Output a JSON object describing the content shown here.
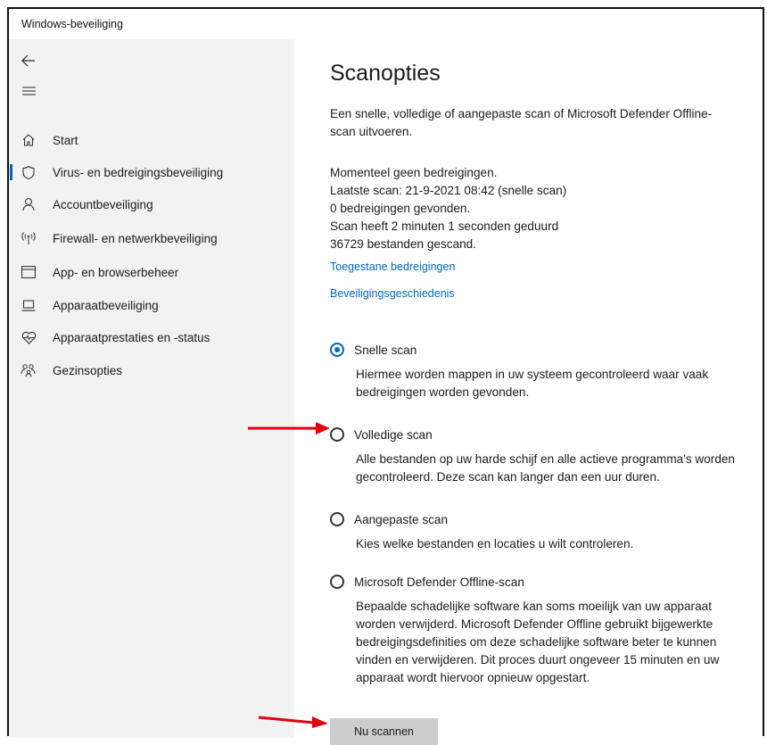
{
  "window": {
    "title": "Windows-beveiliging"
  },
  "sidebar": {
    "items": [
      {
        "label": "Start",
        "icon": "home-icon"
      },
      {
        "label": "Virus- en bedreigingsbeveiliging",
        "icon": "shield-icon",
        "active": true
      },
      {
        "label": "Accountbeveiliging",
        "icon": "person-icon"
      },
      {
        "label": "Firewall- en netwerkbeveiliging",
        "icon": "antenna-icon"
      },
      {
        "label": "App- en browserbeheer",
        "icon": "browser-window-icon"
      },
      {
        "label": "Apparaatbeveiliging",
        "icon": "laptop-icon"
      },
      {
        "label": "Apparaatprestaties en -status",
        "icon": "heart-pulse-icon"
      },
      {
        "label": "Gezinsopties",
        "icon": "family-icon"
      }
    ]
  },
  "main": {
    "title": "Scanopties",
    "description": "Een snelle, volledige of aangepaste scan of Microsoft Defender Offline-scan uitvoeren.",
    "status": {
      "line1": "Momenteel geen bedreigingen.",
      "line2": "Laatste scan: 21-9-2021 08:42 (snelle scan)",
      "line3": "0 bedreigingen gevonden.",
      "line4": "Scan heeft 2 minuten 1 seconden geduurd",
      "line5": "36729 bestanden gescand."
    },
    "links": {
      "allowed": "Toegestane bedreigingen",
      "history": "Beveiligingsgeschiedenis"
    },
    "options": [
      {
        "label": "Snelle scan",
        "description": "Hiermee worden mappen in uw systeem gecontroleerd waar vaak bedreigingen worden gevonden.",
        "selected": true
      },
      {
        "label": "Volledige scan",
        "description": "Alle bestanden op uw harde schijf en alle actieve programma's worden gecontroleerd. Deze scan kan langer dan een uur duren.",
        "selected": false
      },
      {
        "label": "Aangepaste scan",
        "description": "Kies welke bestanden en locaties u wilt controleren.",
        "selected": false
      },
      {
        "label": "Microsoft Defender Offline-scan",
        "description": "Bepaalde schadelijke software kan soms moeilijk van uw apparaat worden verwijderd. Microsoft Defender Offline gebruikt bijgewerkte bedreigingsdefinities om deze schadelijke software beter te kunnen vinden en verwijderen. Dit proces duurt ongeveer 15 minuten en uw apparaat wordt hiervoor opnieuw opgestart.",
        "selected": false
      }
    ],
    "scan_button": "Nu scannen"
  },
  "colors": {
    "accent": "#0067b8",
    "arrow": "#e0000f",
    "sidebar_bg": "#f2f2f2",
    "button_bg": "#cccccc"
  }
}
